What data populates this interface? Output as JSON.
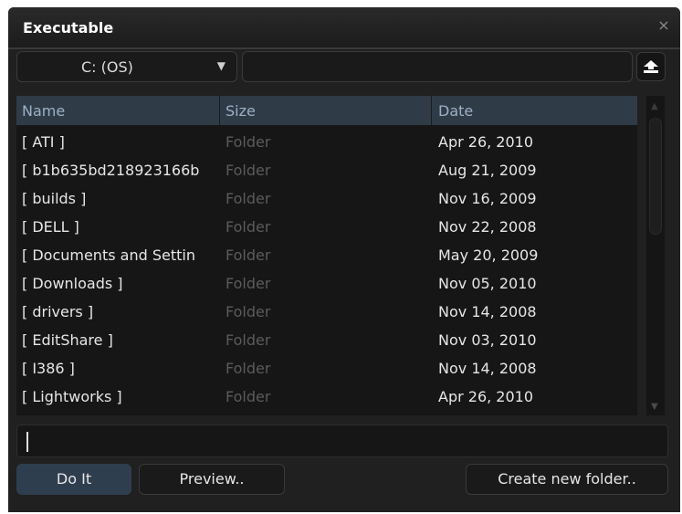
{
  "window": {
    "title": "Executable",
    "close_glyph": "×"
  },
  "drive": {
    "selected": "C: (OS)"
  },
  "path": {
    "value": ""
  },
  "columns": {
    "name": "Name",
    "size": "Size",
    "date": "Date"
  },
  "rows": [
    {
      "name": "[ ATI ]",
      "size": "Folder",
      "date": "Apr 26, 2010"
    },
    {
      "name": "[ b1b635bd218923166b",
      "size": "Folder",
      "date": "Aug 21, 2009"
    },
    {
      "name": "[ builds ]",
      "size": "Folder",
      "date": "Nov 16, 2009"
    },
    {
      "name": "[ DELL ]",
      "size": "Folder",
      "date": "Nov 22, 2008"
    },
    {
      "name": "[ Documents and Settin",
      "size": "Folder",
      "date": "May 20, 2009"
    },
    {
      "name": "[ Downloads ]",
      "size": "Folder",
      "date": "Nov 05, 2010"
    },
    {
      "name": "[ drivers ]",
      "size": "Folder",
      "date": "Nov 14, 2008"
    },
    {
      "name": "[ EditShare ]",
      "size": "Folder",
      "date": "Nov 03, 2010"
    },
    {
      "name": "[ I386 ]",
      "size": "Folder",
      "date": "Nov 14, 2008"
    },
    {
      "name": "[ Lightworks ]",
      "size": "Folder",
      "date": "Apr 26, 2010"
    }
  ],
  "filename": {
    "value": ""
  },
  "buttons": {
    "do_it": "Do It",
    "preview": "Preview..",
    "create_folder": "Create new folder.."
  },
  "colors": {
    "accent": "#2f3e4f",
    "header": "#2f3b47",
    "background": "#202020"
  }
}
